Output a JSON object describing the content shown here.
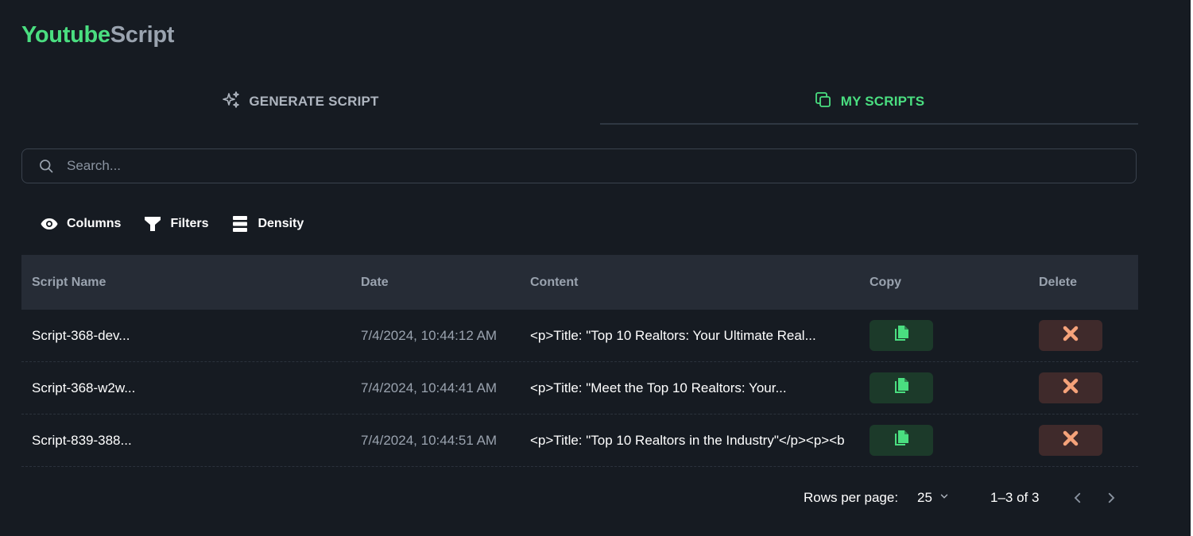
{
  "app": {
    "brand_part1": "Youtube",
    "brand_part2": "Script"
  },
  "tabs": [
    {
      "label": "GENERATE SCRIPT",
      "icon": "sparkles-icon",
      "active": false
    },
    {
      "label": "MY SCRIPTS",
      "icon": "copy-stack-icon",
      "active": true
    }
  ],
  "search": {
    "placeholder": "Search...",
    "value": ""
  },
  "toolbar": {
    "columns_label": "Columns",
    "filters_label": "Filters",
    "density_label": "Density"
  },
  "table": {
    "headers": {
      "name": "Script Name",
      "date": "Date",
      "content": "Content",
      "copy": "Copy",
      "delete": "Delete"
    },
    "rows": [
      {
        "name": "Script-368-dev...",
        "date": "7/4/2024, 10:44:12 AM",
        "content": "<p>Title: \"Top 10 Realtors: Your Ultimate Real..."
      },
      {
        "name": "Script-368-w2w...",
        "date": "7/4/2024, 10:44:41 AM",
        "content": "<p>Title: \"Meet the Top 10 Realtors: Your..."
      },
      {
        "name": "Script-839-388...",
        "date": "7/4/2024, 10:44:51 AM",
        "content": "<p>Title: \"Top 10 Realtors in the Industry\"</p><p><b"
      }
    ]
  },
  "pagination": {
    "rows_per_page_label": "Rows per page:",
    "rows_per_page": "25",
    "range": "1–3 of 3"
  },
  "colors": {
    "accent": "#4ade80",
    "background": "#161b22",
    "header_bg": "#262c36",
    "copy_bg": "#1c3a2a",
    "delete_bg": "#3f2a2b",
    "delete_icon": "#f5a27a"
  }
}
